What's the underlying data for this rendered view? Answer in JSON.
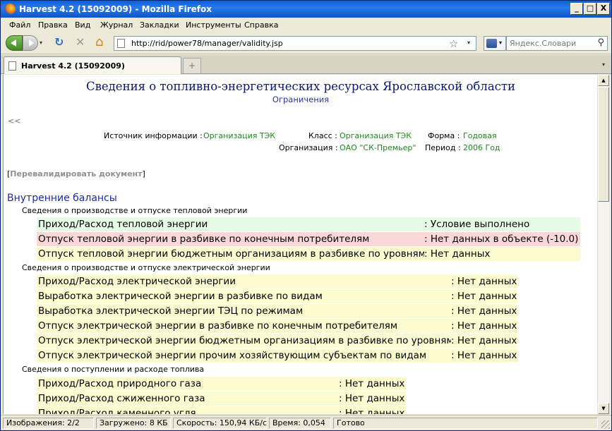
{
  "window": {
    "title": "Harvest 4.2 (15092009) - Mozilla Firefox",
    "btn_min": "_",
    "btn_max": "□",
    "btn_close": "X"
  },
  "menu": [
    "Файл",
    "Правка",
    "Вид",
    "Журнал",
    "Закладки",
    "Инструменты",
    "Справка"
  ],
  "nav": {
    "url": "http://rid/power78/manager/validity.jsp",
    "search_placeholder": "Яндекс.Словари",
    "dropdown_glyph": "▾",
    "reload_glyph": "↻",
    "stop_glyph": "✕",
    "home_glyph": "⌂",
    "star_glyph": "☆",
    "search_glyph": "⚲"
  },
  "tabs": {
    "active_label": "Harvest 4.2 (15092009)",
    "new_tab_glyph": "+",
    "list_glyph": "▾"
  },
  "page": {
    "title": "Сведения о топливно-энергетических ресурсах Ярославской области",
    "subtitle": "Ограничения",
    "back_link": "<<",
    "meta": {
      "source_label": "Источник информации :",
      "source_value": "Организация ТЭК",
      "class_label": "Класс :",
      "class_value": "Организация ТЭК",
      "form_label": "Форма :",
      "form_value": "Годовая",
      "org_label": "Организация :",
      "org_value": "ОАО \"СК-Премьер\"",
      "period_label": "Период :",
      "period_value": "2006 Год"
    },
    "revalidate": {
      "bracket_open": "[",
      "link": "Перевалидировать документ",
      "bracket_close": "]"
    },
    "section_title": "Внутренние балансы",
    "groups": [
      {
        "title": "Сведения о производстве и отпуске тепловой энергии",
        "rows": [
          {
            "name": "Приход/Расход тепловой энергии",
            "status": ": Условие выполнено",
            "state": "green"
          },
          {
            "name": "Отпуск тепловой энергии в разбивке по конечным потребителям",
            "status": ": Нет данных в объекте (-10.0)",
            "state": "red"
          },
          {
            "name": "Отпуск тепловой энергии бюджетным организациям в разбивке по уровням",
            "status": ": Нет данных",
            "state": "yellow"
          }
        ]
      },
      {
        "title": "Сведения о производстве и отпуске электрической энергии",
        "rows": [
          {
            "name": "Приход/Расход электрической энергии",
            "status": ": Нет данных",
            "state": "yellow"
          },
          {
            "name": "Выработка электрической энергии в разбивке по видам",
            "status": ": Нет данных",
            "state": "yellow"
          },
          {
            "name": "Выработка электрической энергии ТЭЦ по режимам",
            "status": ": Нет данных",
            "state": "yellow"
          },
          {
            "name": "Отпуск электрической энергии в разбивке по конечным потребителям",
            "status": ": Нет данных",
            "state": "yellow"
          },
          {
            "name": "Отпуск электрической энергии бюджетным организациям в разбивке по уровням",
            "status": ": Нет данных",
            "state": "yellow"
          },
          {
            "name": "Отпуск электрической энергии прочим хозяйствующим субъектам по видам",
            "status": ": Нет данных",
            "state": "yellow"
          }
        ]
      },
      {
        "title": "Сведения о поступлении и расходе топлива",
        "rows": [
          {
            "name": "Приход/Расход природного газа",
            "status": ": Нет данных",
            "state": "yellow"
          },
          {
            "name": "Приход/Расход сжиженного газа",
            "status": ": Нет данных",
            "state": "yellow"
          },
          {
            "name": "Приход/Расход каменного угля",
            "status": ": Нет данных",
            "state": "yellow"
          }
        ]
      }
    ]
  },
  "status": {
    "images": "Изображения: 2/2",
    "loaded": "Загружено: 8 КБ",
    "speed": "Скорость: 150,94 КБ/с",
    "time": "Время: 0,054",
    "state": "Готово"
  }
}
